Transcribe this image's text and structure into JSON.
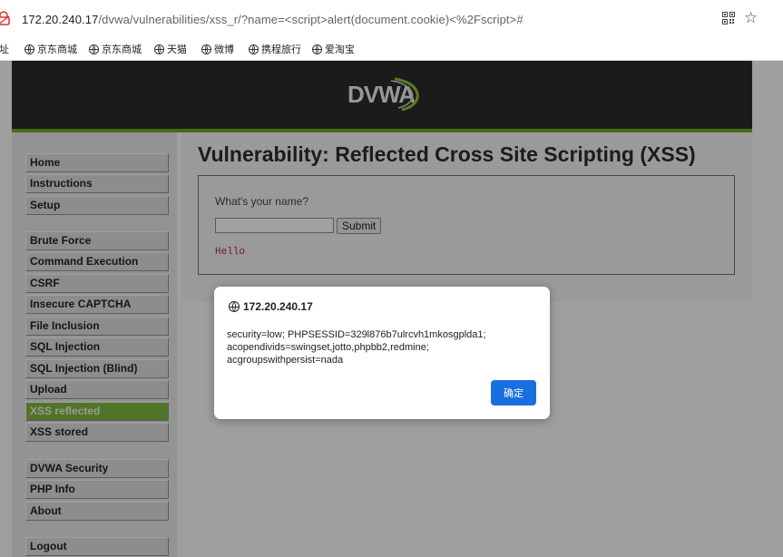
{
  "browser": {
    "url_host": "172.20.240.17",
    "url_path": "/dvwa/vulnerabilities/xss_r/?name=<script>alert(document.cookie)<%2Fscript>#",
    "bookmarks_label": "网址",
    "bookmarks": [
      "京东商城",
      "京东商城",
      "天猫",
      "微博",
      "携程旅行",
      "爱淘宝"
    ]
  },
  "header": {
    "logo_text": "DVWA"
  },
  "menu": {
    "items": [
      {
        "label": "Home"
      },
      {
        "label": "Instructions"
      },
      {
        "label": "Setup"
      },
      {
        "label": "Brute Force"
      },
      {
        "label": "Command Execution"
      },
      {
        "label": "CSRF"
      },
      {
        "label": "Insecure CAPTCHA"
      },
      {
        "label": "File Inclusion"
      },
      {
        "label": "SQL Injection"
      },
      {
        "label": "SQL Injection (Blind)"
      },
      {
        "label": "Upload"
      },
      {
        "label": "XSS reflected"
      },
      {
        "label": "XSS stored"
      },
      {
        "label": "DVWA Security"
      },
      {
        "label": "PHP Info"
      },
      {
        "label": "About"
      },
      {
        "label": "Logout"
      }
    ],
    "active_color": "#7cb23e"
  },
  "main": {
    "title": "Vulnerability: Reflected Cross Site Scripting (XSS)",
    "question": "What's your name?",
    "name_value": "",
    "submit_label": "Submit",
    "output": "Hello"
  },
  "dialog": {
    "title": "172.20.240.17",
    "message": "security=low; PHPSESSID=329l876b7ulrcvh1mkosgplda1; acopendivids=swingset,jotto,phpbb2,redmine; acgroupswithpersist=nada",
    "ok_label": "确定",
    "ok_color": "#1a6fe0"
  }
}
